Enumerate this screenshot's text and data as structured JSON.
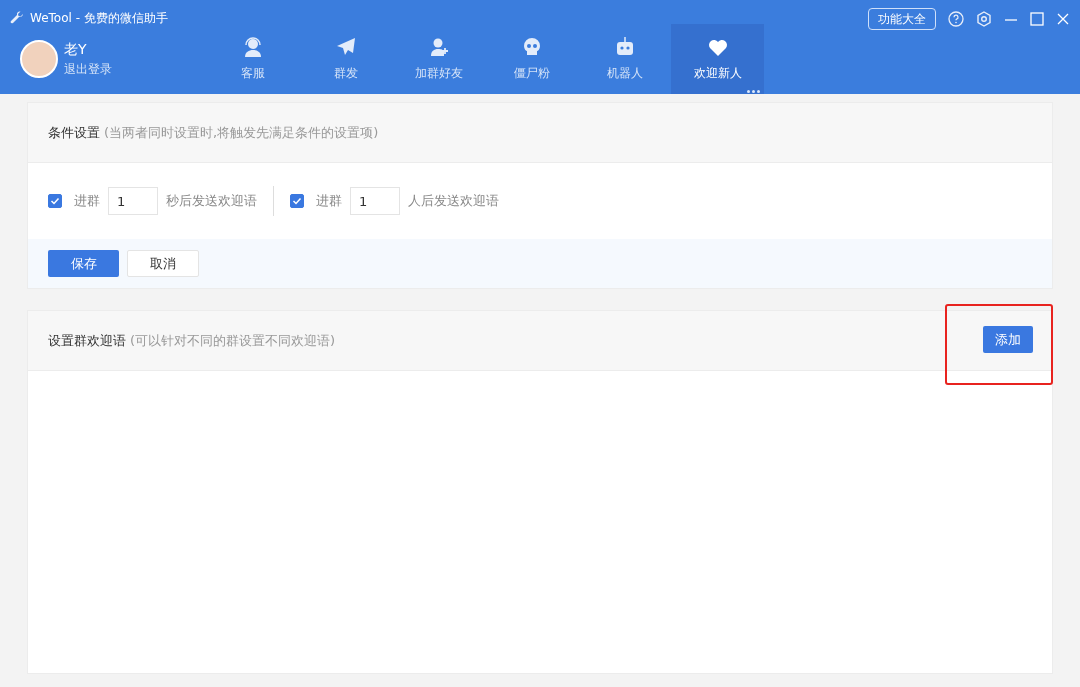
{
  "window": {
    "title": "WeTool - 免费的微信助手",
    "features_button": "功能大全"
  },
  "user": {
    "name": "老Y",
    "logout": "退出登录"
  },
  "tabs": [
    {
      "label": "客服",
      "kind": "headset",
      "selected": false
    },
    {
      "label": "群发",
      "kind": "plane",
      "selected": false
    },
    {
      "label": "加群好友",
      "kind": "adduser",
      "selected": false
    },
    {
      "label": "僵尸粉",
      "kind": "skull",
      "selected": false
    },
    {
      "label": "机器人",
      "kind": "robot",
      "selected": false
    },
    {
      "label": "欢迎新人",
      "kind": "heart",
      "selected": true
    }
  ],
  "conditions": {
    "title": "条件设置",
    "hint": "(当两者同时设置时,将触发先满足条件的设置项)",
    "rules": [
      {
        "checked": true,
        "prefix": "进群",
        "value": "1",
        "suffix": "秒后发送欢迎语"
      },
      {
        "checked": true,
        "prefix": "进群",
        "value": "1",
        "suffix": "人后发送欢迎语"
      }
    ],
    "save": "保存",
    "cancel": "取消"
  },
  "greetings": {
    "title": "设置群欢迎语",
    "hint": "(可以针对不同的群设置不同欢迎语)",
    "add": "添加"
  }
}
